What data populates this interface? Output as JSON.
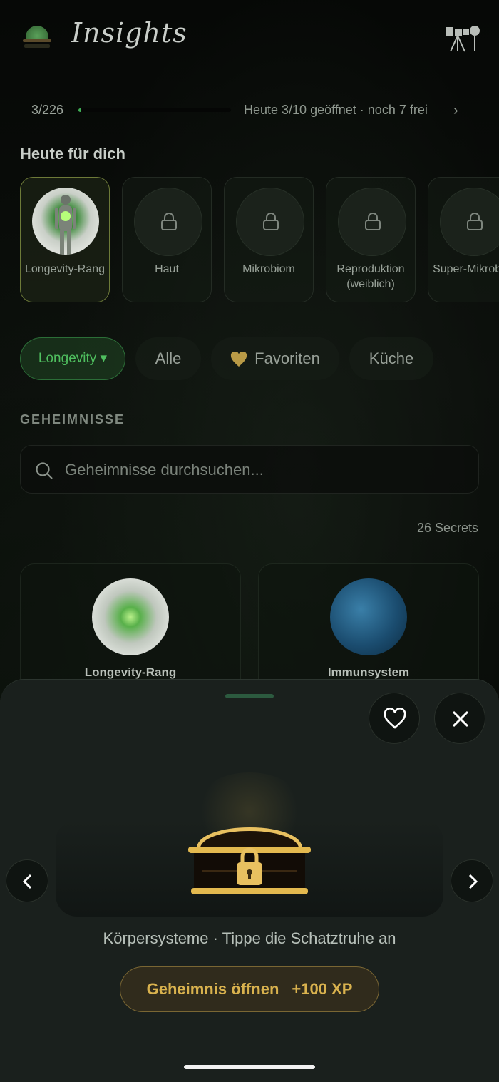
{
  "app": {
    "title": "Insights"
  },
  "progress": {
    "count": "3/226",
    "fraction": 0.013,
    "status": "Heute 3/10 geöffnet · noch 7 frei"
  },
  "today": {
    "heading": "Heute für dich",
    "cards": [
      {
        "label": "Longevity-Rang",
        "locked": false
      },
      {
        "label": "Haut",
        "locked": true
      },
      {
        "label": "Mikrobiom",
        "locked": true
      },
      {
        "label": "Reproduktion (weiblich)",
        "locked": true
      },
      {
        "label": "Super-Mikroben",
        "locked": true
      }
    ]
  },
  "filters": {
    "selected": "Longevity",
    "chips": [
      "Longevity ▾",
      "Alle",
      "Favoriten",
      "Küche"
    ]
  },
  "secrets": {
    "heading": "GEHEIMNISSE",
    "search_placeholder": "Geheimnisse durchsuchen...",
    "count": "26 Secrets",
    "cards": [
      {
        "label": "Longevity-Rang"
      },
      {
        "label": "Immunsystem"
      }
    ]
  },
  "sheet": {
    "caption": "Körpersysteme · Tippe die Schatztruhe an",
    "open_button": "Geheimnis öffnen",
    "xp": "+100 XP"
  },
  "colors": {
    "accent_green": "#3fae55",
    "gold": "#d9b24e",
    "sheet_bg": "#1a201d"
  }
}
